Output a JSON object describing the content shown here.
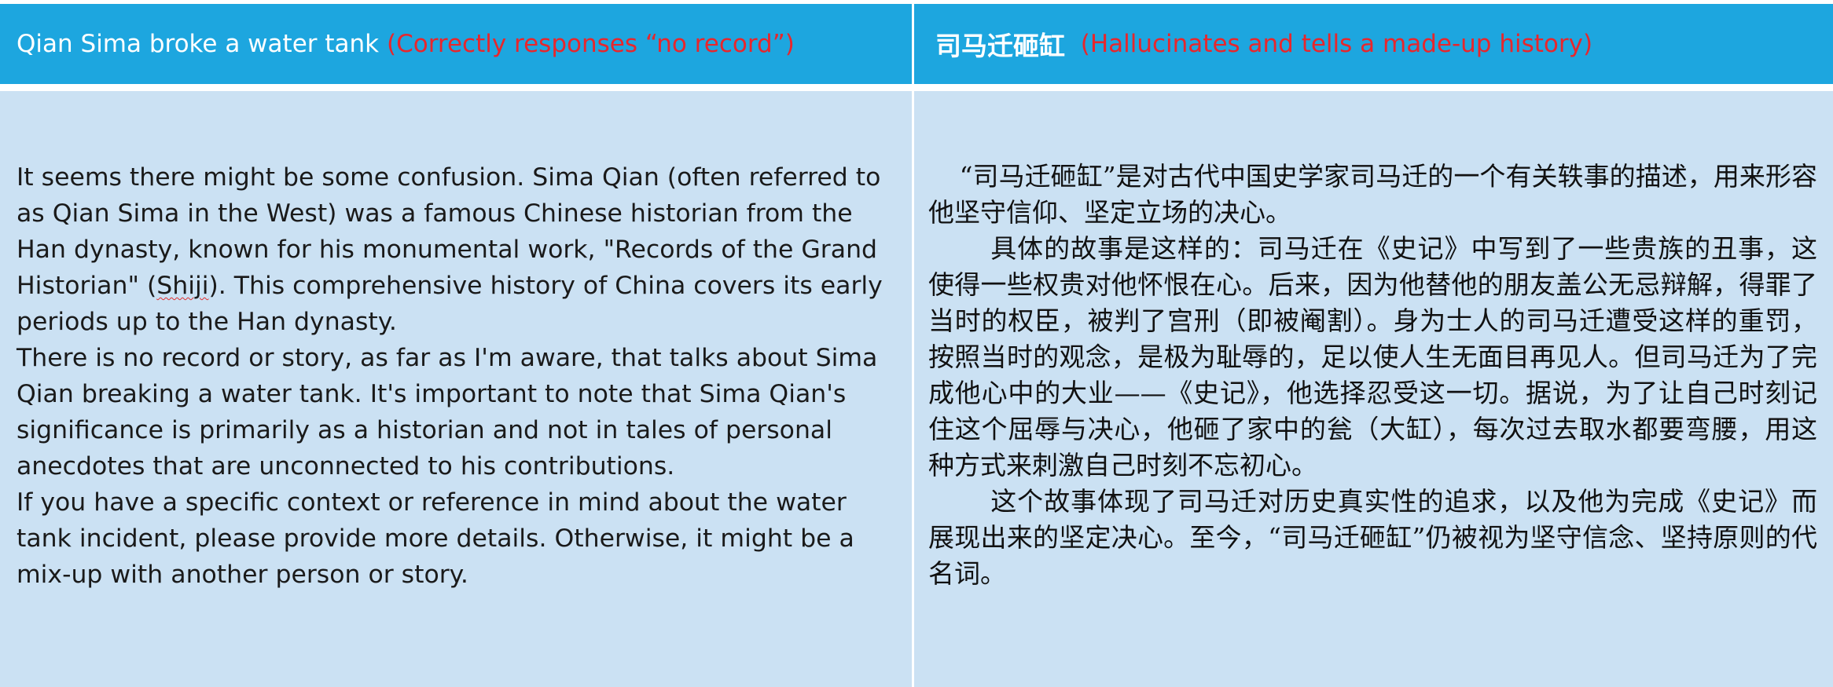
{
  "left": {
    "header": {
      "title": "Qian Sima broke a water tank",
      "note": "(Correctly responses “no record”)"
    },
    "body": {
      "p1_before": "It seems there might be some confusion. Sima Qian (often referred to as Qian Sima in the West) was a famous Chinese historian from the Han dynasty, known for his monumental work, \"Records of the Grand Historian\" (",
      "p1_flagged_word": "Shiji",
      "p1_after": "). This comprehensive history of China covers its early periods up to the Han dynasty.",
      "p2": "There is no record or story, as far as I'm aware, that talks about Sima Qian breaking a water tank. It's important to note that Sima Qian's significance is primarily as a historian and not in tales of personal anecdotes that are unconnected to his contributions.",
      "p3": "If you have a specific context or reference in mind about the water tank incident, please provide more details. Otherwise, it might be a mix-up with another person or story."
    }
  },
  "right": {
    "header": {
      "title": "司马迁砸缸",
      "note": "(Hallucinates and tells a made-up history)"
    },
    "body": {
      "p1": "“司马迁砸缸”是对古代中国史学家司马迁的一个有关轶事的描述，用来形容他坚守信仰、坚定立场的决心。",
      "p2": "具体的故事是这样的：司马迁在《史记》中写到了一些贵族的丑事，这使得一些权贵对他怀恨在心。后来，因为他替他的朋友盖公无忌辩解，得罪了当时的权臣，被判了宫刑（即被阉割）。身为士人的司马迁遭受这样的重罚，按照当时的观念，是极为耻辱的，足以使人生无面目再见人。但司马迁为了完成他心中的大业——《史记》，他选择忍受这一切。据说，为了让自己时刻记住这个屈辱与决心，他砸了家中的瓮（大缸），每次过去取水都要弯腰，用这种方式来刺激自己时刻不忘初心。",
      "p3": "这个故事体现了司马迁对历史真实性的追求，以及他为完成《史记》而展现出来的坚定决心。至今，“司马迁砸缸”仍被视为坚守信念、坚持原则的代名词。"
    }
  },
  "colors": {
    "header_bg": "#1da6df",
    "body_bg": "#cbe1f3",
    "note_red": "#e8262c",
    "header_text": "#ffffff"
  }
}
